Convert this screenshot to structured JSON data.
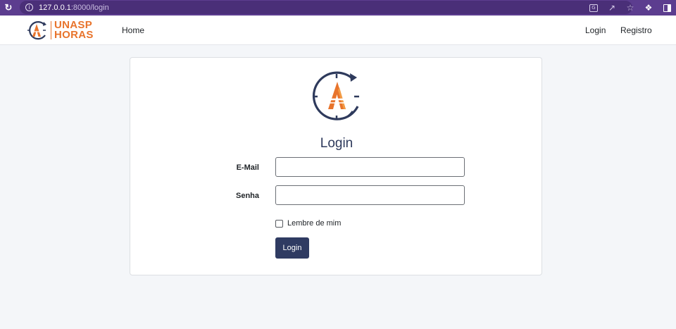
{
  "browser": {
    "url_host": "127.0.0.1",
    "url_path": ":8000/login"
  },
  "navbar": {
    "brand_line1": "UNASP",
    "brand_line2": "HORAS",
    "home_label": "Home",
    "login_label": "Login",
    "register_label": "Registro"
  },
  "login_form": {
    "title": "Login",
    "email_label": "E-Mail",
    "email_value": "",
    "password_label": "Senha",
    "password_value": "",
    "remember_label": "Lembre de mim",
    "remember_checked": false,
    "submit_label": "Login"
  },
  "colors": {
    "browser_frame": "#5c3d8f",
    "brand_orange": "#e8742c",
    "primary_navy": "#2f3b62",
    "page_background": "#f4f6f9"
  }
}
